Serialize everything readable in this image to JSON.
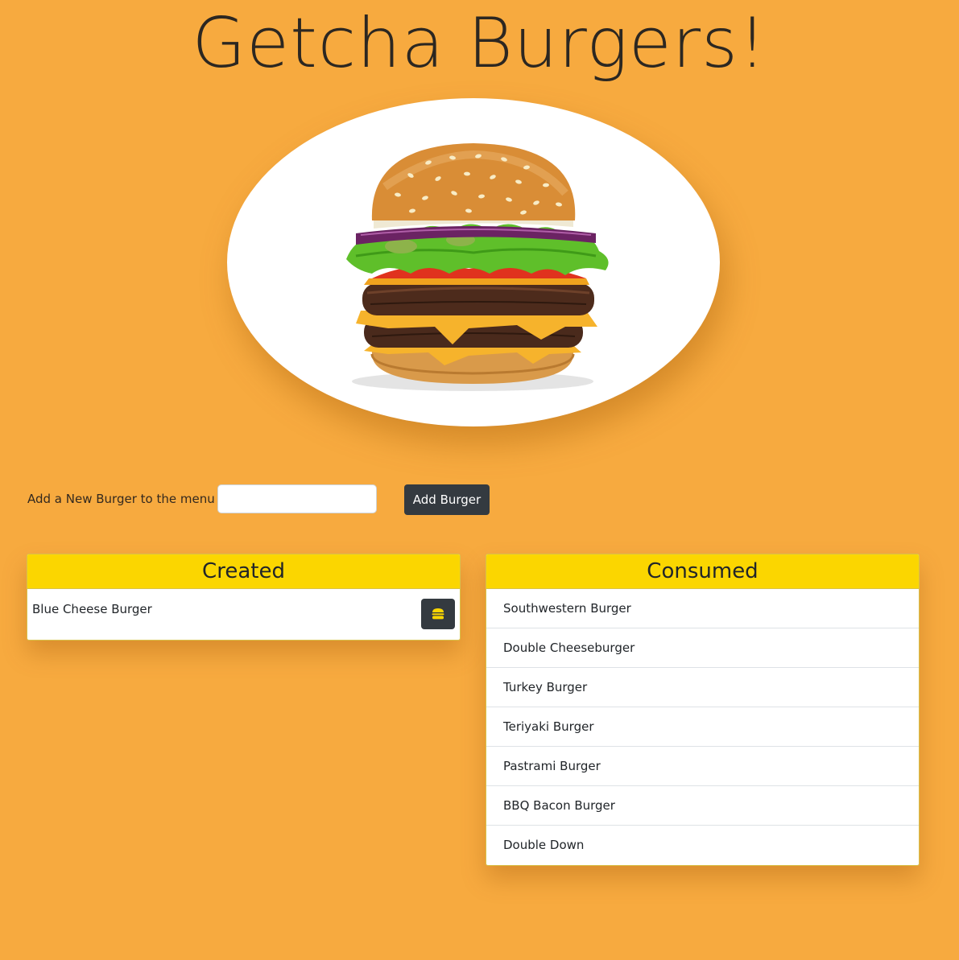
{
  "page": {
    "title": "Getcha Burgers!"
  },
  "form": {
    "label": "Add a New Burger to the menu",
    "input_value": "",
    "input_placeholder": "",
    "button_label": "Add Burger"
  },
  "created": {
    "heading": "Created",
    "items": [
      {
        "name": "Blue Cheese Burger",
        "action_icon": "burger-icon"
      }
    ]
  },
  "consumed": {
    "heading": "Consumed",
    "items": [
      "Southwestern Burger",
      "Double Cheeseburger",
      "Turkey Burger",
      "Teriyaki Burger",
      "Pastrami Burger",
      "BBQ Bacon Burger",
      "Double Down"
    ]
  },
  "colors": {
    "page_background": "#f7aa3f",
    "panel_header": "#fbd600",
    "button": "#343a40",
    "icon_accent": "#fbd600"
  }
}
